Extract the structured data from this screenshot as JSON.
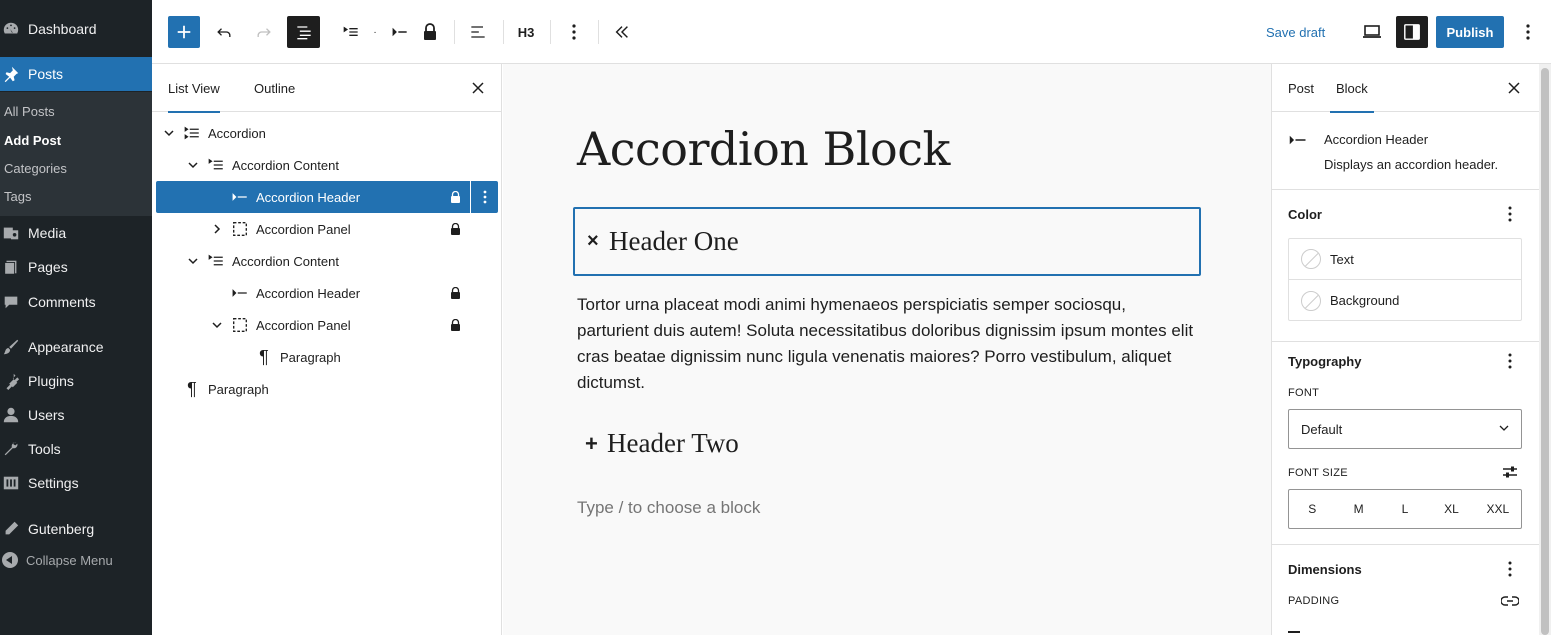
{
  "admin_menu": {
    "items": [
      {
        "label": "Dashboard",
        "icon": "dashboard-icon"
      },
      {
        "label": "Posts",
        "icon": "pin-icon",
        "active": true
      },
      {
        "label": "Media",
        "icon": "media-icon"
      },
      {
        "label": "Pages",
        "icon": "pages-icon"
      },
      {
        "label": "Comments",
        "icon": "comments-icon"
      },
      {
        "label": "Appearance",
        "icon": "brush-icon"
      },
      {
        "label": "Plugins",
        "icon": "plugin-icon"
      },
      {
        "label": "Users",
        "icon": "user-icon"
      },
      {
        "label": "Tools",
        "icon": "wrench-icon"
      },
      {
        "label": "Settings",
        "icon": "settings-icon"
      },
      {
        "label": "Gutenberg",
        "icon": "pencil-icon"
      }
    ],
    "posts_submenu": [
      {
        "label": "All Posts"
      },
      {
        "label": "Add Post",
        "current": true
      },
      {
        "label": "Categories"
      },
      {
        "label": "Tags"
      }
    ],
    "collapse_label": "Collapse Menu"
  },
  "toolbar": {
    "heading_level": "H3",
    "save_draft_label": "Save draft",
    "publish_label": "Publish"
  },
  "list_view": {
    "tabs": [
      {
        "label": "List View",
        "active": true
      },
      {
        "label": "Outline"
      }
    ],
    "rows": [
      {
        "label": "Accordion"
      },
      {
        "label": "Accordion Content"
      },
      {
        "label": "Accordion Header",
        "selected": true
      },
      {
        "label": "Accordion Panel"
      },
      {
        "label": "Accordion Content"
      },
      {
        "label": "Accordion Header"
      },
      {
        "label": "Accordion Panel"
      },
      {
        "label": "Paragraph"
      },
      {
        "label": "Paragraph"
      }
    ]
  },
  "canvas": {
    "title": "Accordion Block",
    "header_one": {
      "symbol": "×",
      "text": "Header One"
    },
    "panel_text": "Tortor urna placeat modi animi hymenaeos perspiciatis semper sociosqu, parturient duis autem! Soluta necessitatibus doloribus dignissim ipsum montes elit cras beatae dignissim nunc ligula venenatis maiores? Porro vestibulum, aliquet dictumst.",
    "header_two": {
      "symbol": "+",
      "text": "Header Two"
    },
    "placeholder": "Type / to choose a block"
  },
  "settings": {
    "tabs": [
      {
        "label": "Post"
      },
      {
        "label": "Block",
        "active": true
      }
    ],
    "block_card": {
      "title": "Accordion Header",
      "description": "Displays an accordion header."
    },
    "color": {
      "title": "Color",
      "items": [
        "Text",
        "Background"
      ]
    },
    "typography": {
      "title": "Typography",
      "font_label": "FONT",
      "font_value": "Default",
      "font_size_label": "FONT SIZE",
      "sizes": [
        "S",
        "M",
        "L",
        "XL",
        "XXL"
      ]
    },
    "dimensions": {
      "title": "Dimensions",
      "padding_label": "PADDING"
    }
  },
  "colors": {
    "admin_bg": "#1d2327",
    "admin_accent": "#2271b1",
    "primary": "#2271b1",
    "canvas_bg": "#f9f9f9"
  }
}
